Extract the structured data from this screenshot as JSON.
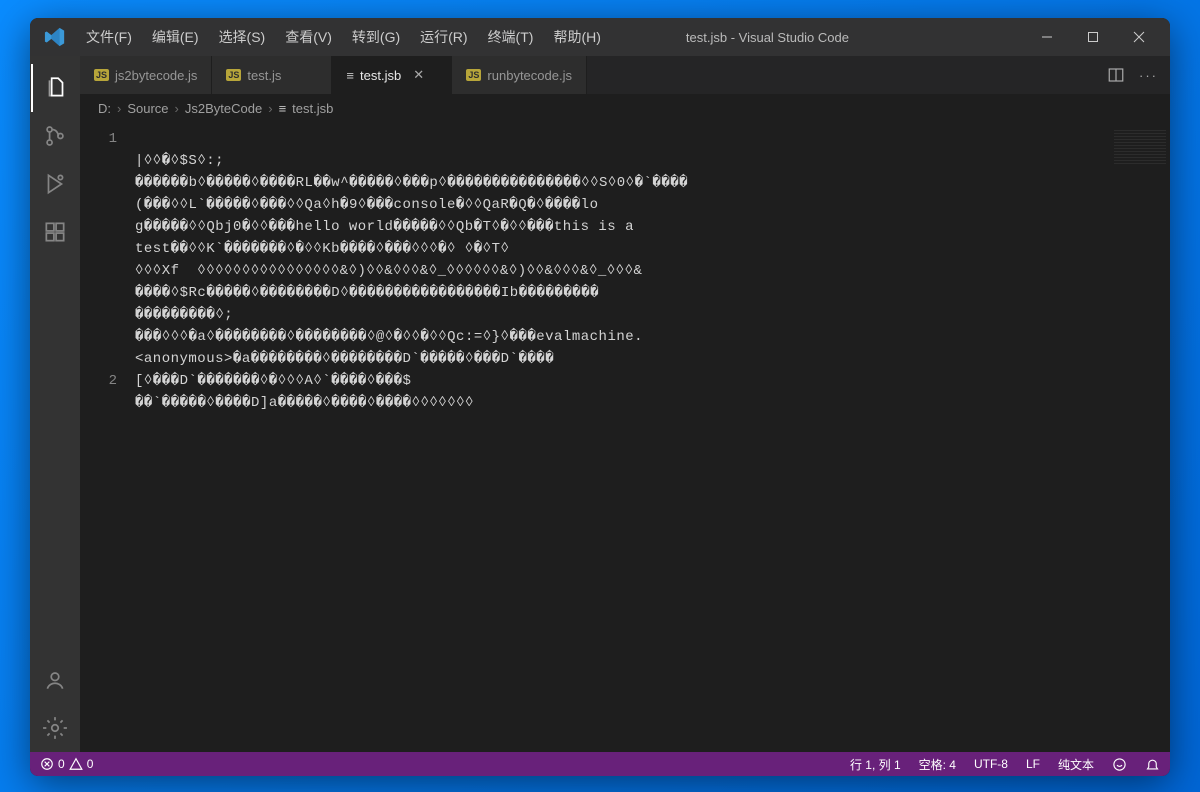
{
  "window": {
    "title": "test.jsb - Visual Studio Code"
  },
  "menu": {
    "file": "文件(F)",
    "edit": "编辑(E)",
    "select": "选择(S)",
    "view": "查看(V)",
    "go": "转到(G)",
    "run": "运行(R)",
    "terminal": "终端(T)",
    "help": "帮助(H)"
  },
  "tabs": [
    {
      "label": "js2bytecode.js",
      "kind": "js",
      "active": false
    },
    {
      "label": "test.js",
      "kind": "js",
      "active": false
    },
    {
      "label": "test.jsb",
      "kind": "bin",
      "active": true
    },
    {
      "label": "runbytecode.js",
      "kind": "js",
      "active": false
    }
  ],
  "breadcrumb": {
    "drive": "D:",
    "seg1": "Source",
    "seg2": "Js2ByteCode",
    "file": "test.jsb"
  },
  "code": {
    "l1a": "|◊◊�◊$S◊:;",
    "l1b": "������b◊�����◊����RL��w^�����◊���p◊���������������◊◊S◊0◊�`����",
    "l1c": "(���◊◊L`�����◊���◊◊Qa◊h�9◊���console�◊◊QaR�Q�◊����lo",
    "l1d": "g�����◊◊Qbj0�◊◊���hello world�����◊◊Qb�T◊�◊◊���this is a ",
    "l1e": "test��◊◊K`�������◊�◊◊Kb����◊���◊◊◊�◊ ◊�◊T◊",
    "l1f": "◊◊◊Xf  ◊◊◊◊◊◊◊◊◊◊◊◊◊◊◊◊&◊)◊◊&◊◊◊&◊_◊◊◊◊◊◊&◊)◊◊&◊◊◊&◊_◊◊◊&",
    "l1g": "����◊$Rc�����◊��������D◊�����������������Ib���������",
    "l1h": "���������◊;",
    "l1i": "���◊◊◊�a◊��������◊��������◊@◊�◊◊�◊◊Qc:=◊}◊���evalmachine.",
    "l1j": "<anonymous>�a��������◊��������D`�����◊���D`����",
    "l1k": "[◊���D`�������◊�◊◊◊A◊`����◊���$",
    "l2": "��`�����◊����D]a�����◊����◊����◊◊◊◊◊◊◊"
  },
  "gutter": {
    "l1": "1",
    "l2": "2"
  },
  "status": {
    "errors": "0",
    "warnings": "0",
    "ln_col": "行 1, 列 1",
    "spaces": "空格: 4",
    "encoding": "UTF-8",
    "eol": "LF",
    "lang": "纯文本"
  }
}
